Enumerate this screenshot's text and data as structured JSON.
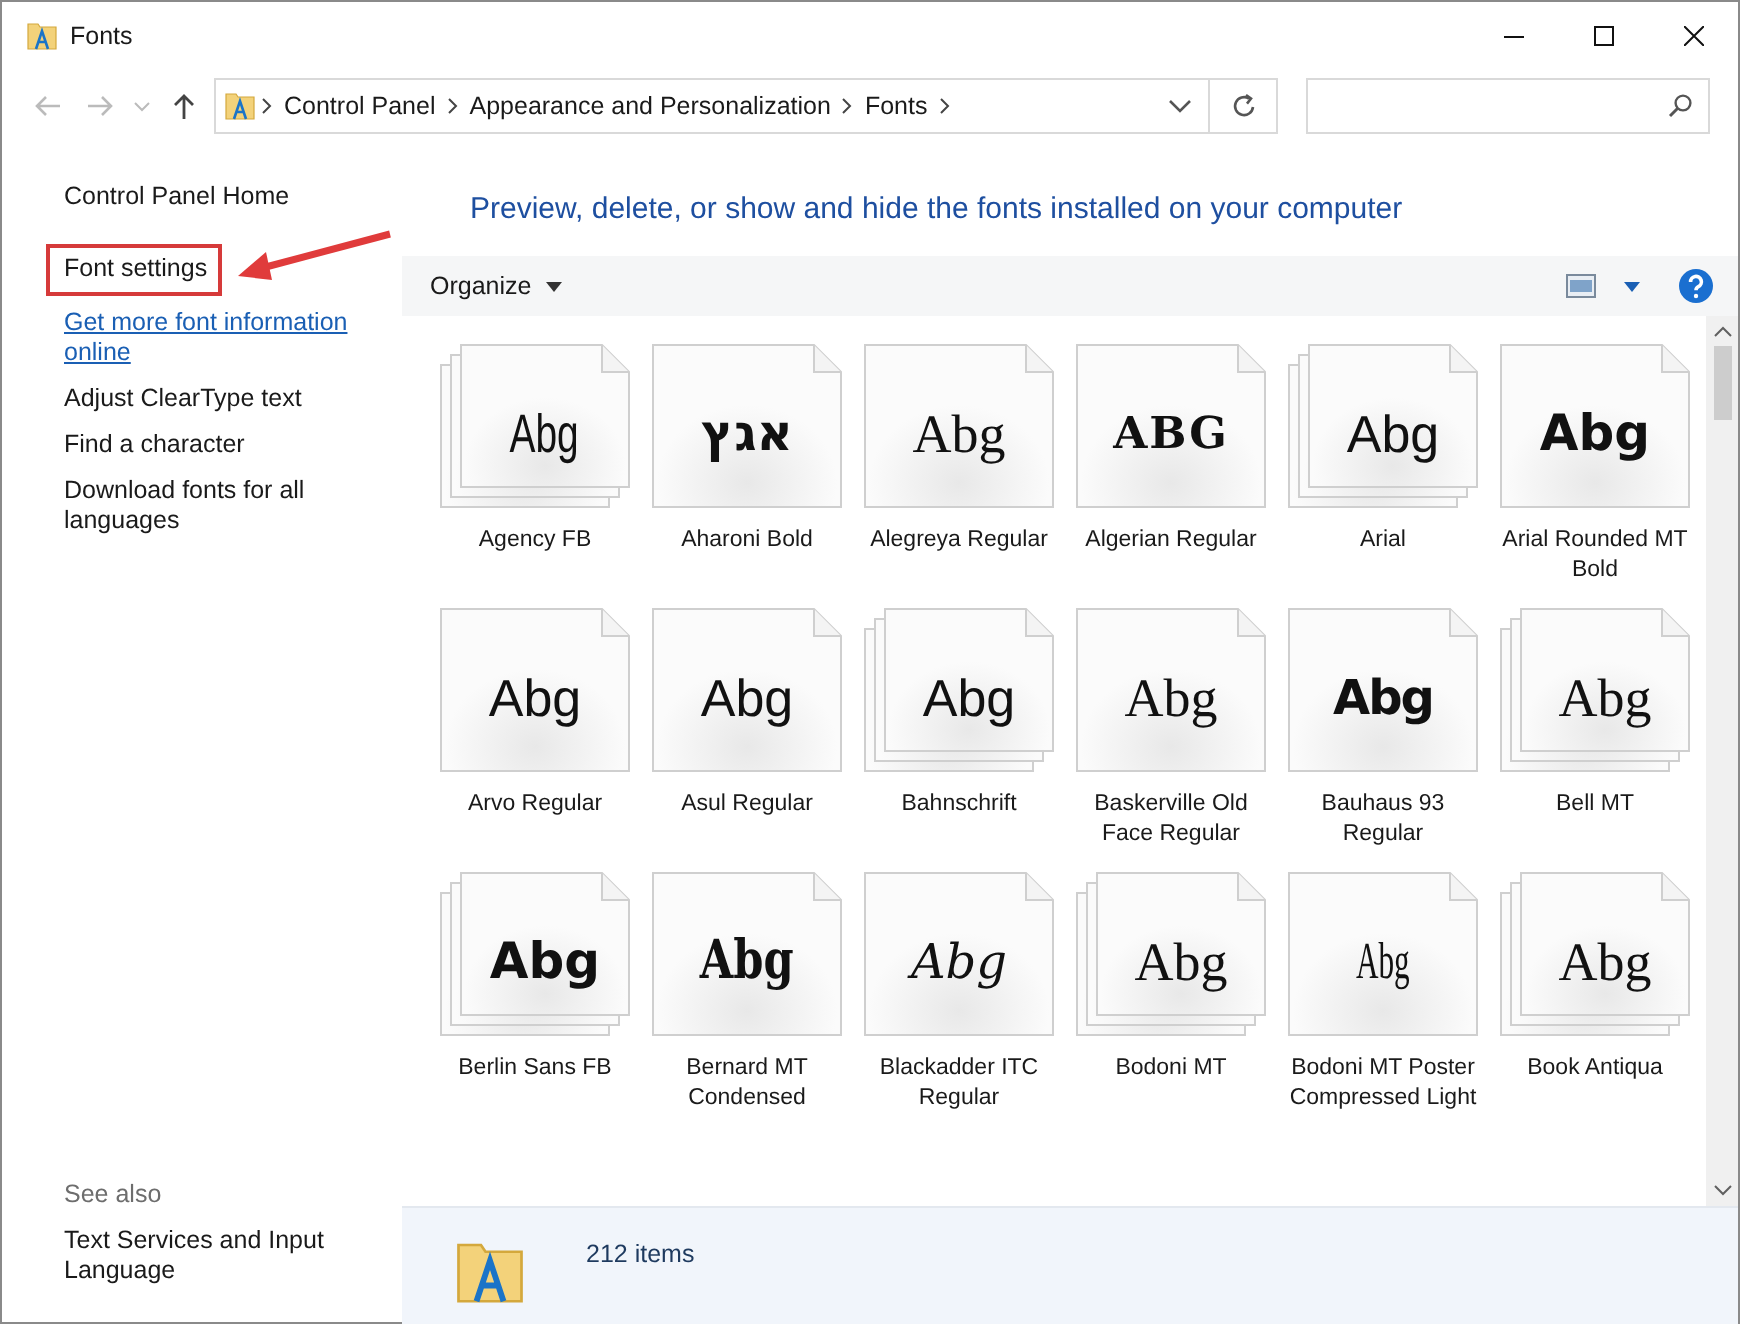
{
  "window": {
    "title": "Fonts"
  },
  "address_bar": {
    "breadcrumbs": [
      "Control Panel",
      "Appearance and Personalization",
      "Fonts"
    ]
  },
  "task_pane": {
    "items": [
      {
        "label": "Control Panel Home",
        "kind": "task",
        "highlighted": false
      },
      {
        "label": "Font settings",
        "kind": "task",
        "highlighted": true
      },
      {
        "label": "Get more font information online",
        "kind": "hyperlink",
        "highlighted": false
      },
      {
        "label": "Adjust ClearType text",
        "kind": "task",
        "highlighted": false
      },
      {
        "label": "Find a character",
        "kind": "task",
        "highlighted": false
      },
      {
        "label": "Download fonts for all languages",
        "kind": "task",
        "highlighted": false
      }
    ],
    "see_also": {
      "heading": "See also",
      "items": [
        {
          "label": "Text Services and Input Language"
        }
      ]
    }
  },
  "heading": "Preview, delete, or show and hide the fonts installed on your computer",
  "toolbar": {
    "organize": "Organize"
  },
  "fonts": [
    {
      "name": "Agency FB",
      "sample": "Abg",
      "kind": "condensed",
      "stacked": true
    },
    {
      "name": "Aharoni Bold",
      "sample": "אגץ",
      "kind": "bold",
      "stacked": false
    },
    {
      "name": "Alegreya Regular",
      "sample": "Abg",
      "kind": "serif",
      "stacked": false
    },
    {
      "name": "Algerian Regular",
      "sample": "ABG",
      "kind": "decorative",
      "stacked": false
    },
    {
      "name": "Arial",
      "sample": "Abg",
      "kind": "sans",
      "stacked": true
    },
    {
      "name": "Arial Rounded MT Bold",
      "sample": "Abg",
      "kind": "bold",
      "stacked": false
    },
    {
      "name": "Arvo Regular",
      "sample": "Abg",
      "kind": "sans",
      "stacked": false
    },
    {
      "name": "Asul Regular",
      "sample": "Abg",
      "kind": "sans",
      "stacked": false
    },
    {
      "name": "Bahnschrift",
      "sample": "Abg",
      "kind": "sans",
      "stacked": true
    },
    {
      "name": "Baskerville Old Face Regular",
      "sample": "Abg",
      "kind": "serif",
      "stacked": false
    },
    {
      "name": "Bauhaus 93 Regular",
      "sample": "Abg",
      "kind": "heavy",
      "stacked": false
    },
    {
      "name": "Bell MT",
      "sample": "Abg",
      "kind": "serif",
      "stacked": true
    },
    {
      "name": "Berlin Sans FB",
      "sample": "Abg",
      "kind": "bold",
      "stacked": true
    },
    {
      "name": "Bernard MT Condensed",
      "sample": "Abg",
      "kind": "heavy-condensed",
      "stacked": false
    },
    {
      "name": "Blackadder ITC Regular",
      "sample": "Abg",
      "kind": "script",
      "stacked": false
    },
    {
      "name": "Bodoni MT",
      "sample": "Abg",
      "kind": "serif",
      "stacked": true
    },
    {
      "name": "Bodoni MT Poster Compressed Light",
      "sample": "Abg",
      "kind": "serif-condensed",
      "stacked": false
    },
    {
      "name": "Book Antiqua",
      "sample": "Abg",
      "kind": "serif",
      "stacked": true
    }
  ],
  "status_bar": {
    "count": "212 items"
  }
}
